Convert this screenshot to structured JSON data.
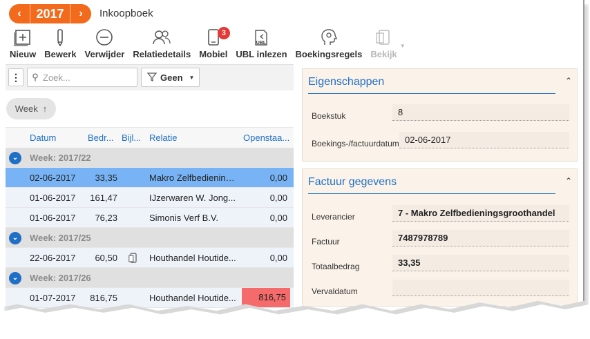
{
  "header": {
    "year": "2017",
    "prev_icon": "chevron-left-icon",
    "next_icon": "chevron-right-icon",
    "title": "Inkoopboek"
  },
  "toolbar": {
    "nieuw": "Nieuw",
    "bewerk": "Bewerk",
    "verwijder": "Verwijder",
    "relatiedetails": "Relatiedetails",
    "mobiel": "Mobiel",
    "mobiel_badge": "3",
    "ubl_inlezen": "UBL inlezen",
    "ubl_icon_text": "UBL",
    "boekingsregels": "Boekingsregels",
    "bekijk": "Bekijk"
  },
  "search": {
    "placeholder": "Zoek...",
    "filter_label": "Geen"
  },
  "grouping": {
    "label": "Week",
    "sort_icon": "arrow-up-icon"
  },
  "grid": {
    "columns": {
      "datum": "Datum",
      "bedrag": "Bedr...",
      "bijlage": "Bijl...",
      "relatie": "Relatie",
      "openstaand": "Openstaa..."
    },
    "groups": [
      {
        "label": "Week: 2017/22",
        "rows": [
          {
            "datum": "02-06-2017",
            "bedrag": "33,35",
            "relatie": "Makro Zelfbediening...",
            "openstaand": "0,00"
          },
          {
            "datum": "01-06-2017",
            "bedrag": "161,47",
            "relatie": "IJzerwaren W. Jong...",
            "openstaand": "0,00"
          },
          {
            "datum": "01-06-2017",
            "bedrag": "76,23",
            "relatie": "Simonis Verf B.V.",
            "openstaand": "0,00"
          }
        ]
      },
      {
        "label": "Week: 2017/25",
        "rows": [
          {
            "datum": "22-06-2017",
            "bedrag": "60,50",
            "relatie": "Houthandel Houtide...",
            "openstaand": "0,00"
          }
        ]
      },
      {
        "label": "Week: 2017/26",
        "rows": [
          {
            "datum": "01-07-2017",
            "bedrag": "816,75",
            "relatie": "Houthandel Houtide...",
            "openstaand": "816,75"
          }
        ]
      }
    ]
  },
  "eigenschappen": {
    "title": "Eigenschappen",
    "boekstuk_label": "Boekstuk",
    "boekstuk_value": "8",
    "datum_label": "Boekings-/factuurdatum",
    "datum_value": "02-06-2017"
  },
  "factuur": {
    "title": "Factuur gegevens",
    "leverancier_label": "Leverancier",
    "leverancier_value": "7 - Makro Zelfbedieningsgroothandel",
    "factuur_label": "Factuur",
    "factuur_value": "7487978789",
    "totaal_label": "Totaalbedrag",
    "totaal_value": "33,35",
    "verval_label": "Vervaldatum",
    "verval_value": ""
  },
  "colors": {
    "accent_orange": "#f26a1b",
    "link_blue": "#1f6fc5",
    "selected_row": "#78b4f5",
    "negative_cell": "#f56a6a",
    "card_bg": "#fbf3e9"
  }
}
